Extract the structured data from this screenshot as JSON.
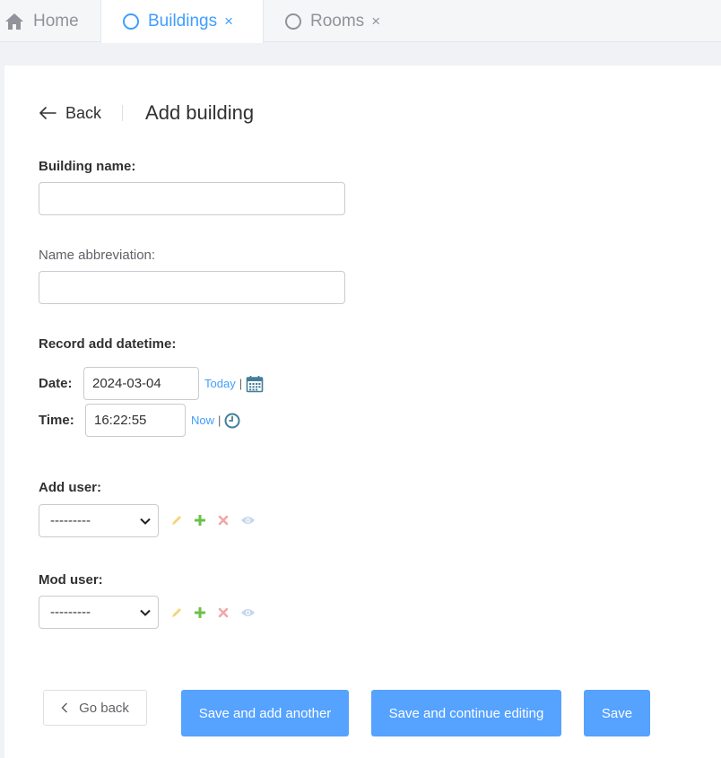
{
  "tabs": [
    {
      "label": "Home",
      "icon": "home-icon"
    },
    {
      "label": "Buildings",
      "icon": "circle-icon",
      "close": "×"
    },
    {
      "label": "Rooms",
      "icon": "circle-icon",
      "close": "×"
    }
  ],
  "header": {
    "back_label": "Back",
    "title": "Add building"
  },
  "form": {
    "building_name": {
      "label": "Building name:",
      "value": ""
    },
    "name_abbreviation": {
      "label": "Name abbreviation:",
      "value": ""
    },
    "record_add_datetime": {
      "label": "Record add datetime:",
      "date_label": "Date:",
      "date_value": "2024-03-04",
      "today_link": "Today",
      "time_label": "Time:",
      "time_value": "16:22:55",
      "now_link": "Now",
      "separator": "|"
    },
    "add_user": {
      "label": "Add user:",
      "value": "---------"
    },
    "mod_user": {
      "label": "Mod user:",
      "value": "---------"
    }
  },
  "buttons": {
    "go_back": "Go back",
    "save_add_another": "Save and add another",
    "save_continue": "Save and continue editing",
    "save": "Save"
  },
  "colors": {
    "accent": "#409eff",
    "primary_button": "#55a2ff",
    "edit": "#f5d37a",
    "add": "#6cc04a",
    "delete": "#f3a6a6",
    "view": "#c5d7ee"
  }
}
